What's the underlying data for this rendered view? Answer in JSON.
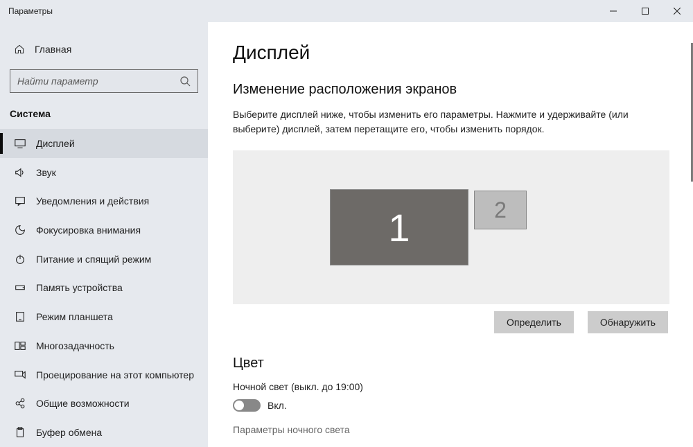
{
  "window": {
    "title": "Параметры"
  },
  "sidebar": {
    "home_label": "Главная",
    "search_placeholder": "Найти параметр",
    "section_label": "Система",
    "items": [
      {
        "label": "Дисплей"
      },
      {
        "label": "Звук"
      },
      {
        "label": "Уведомления и действия"
      },
      {
        "label": "Фокусировка внимания"
      },
      {
        "label": "Питание и спящий режим"
      },
      {
        "label": "Память устройства"
      },
      {
        "label": "Режим планшета"
      },
      {
        "label": "Многозадачность"
      },
      {
        "label": "Проецирование на этот компьютер"
      },
      {
        "label": "Общие возможности"
      },
      {
        "label": "Буфер обмена"
      }
    ]
  },
  "main": {
    "title": "Дисплей",
    "arrangement_heading": "Изменение расположения экранов",
    "arrangement_desc": "Выберите дисплей ниже, чтобы изменить его параметры. Нажмите и удерживайте (или выберите) дисплей, затем перетащите его, чтобы изменить порядок.",
    "monitor1_label": "1",
    "monitor2_label": "2",
    "identify_label": "Определить",
    "detect_label": "Обнаружить",
    "color_heading": "Цвет",
    "night_light_label": "Ночной свет (выкл. до 19:00)",
    "toggle_state": "Вкл.",
    "night_light_settings": "Параметры ночного света"
  }
}
